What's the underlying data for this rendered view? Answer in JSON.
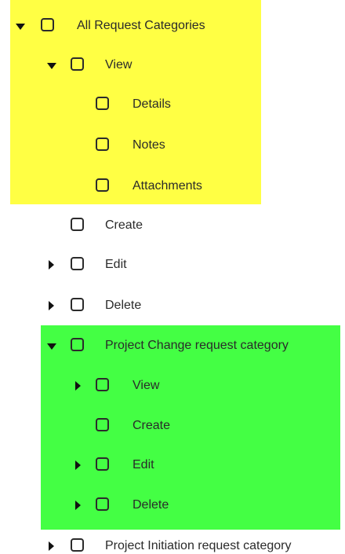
{
  "tree": {
    "items": [
      {
        "label": "All Request Categories",
        "expanded": true,
        "checked": false
      },
      {
        "label": "View",
        "expanded": true,
        "checked": false
      },
      {
        "label": "Details",
        "checked": false
      },
      {
        "label": "Notes",
        "checked": false
      },
      {
        "label": "Attachments",
        "checked": false
      },
      {
        "label": "Create",
        "checked": false
      },
      {
        "label": "Edit",
        "expanded": false,
        "checked": false
      },
      {
        "label": "Delete",
        "expanded": false,
        "checked": false
      },
      {
        "label": "Project Change request category",
        "expanded": true,
        "checked": false
      },
      {
        "label": "View",
        "expanded": false,
        "checked": false
      },
      {
        "label": "Create",
        "checked": false
      },
      {
        "label": "Edit",
        "expanded": false,
        "checked": false
      },
      {
        "label": "Delete",
        "expanded": false,
        "checked": false
      },
      {
        "label": "Project Initiation request category",
        "expanded": false,
        "checked": false
      }
    ]
  },
  "highlights": {
    "yellow": "#ffff44",
    "green": "#44ff44"
  }
}
